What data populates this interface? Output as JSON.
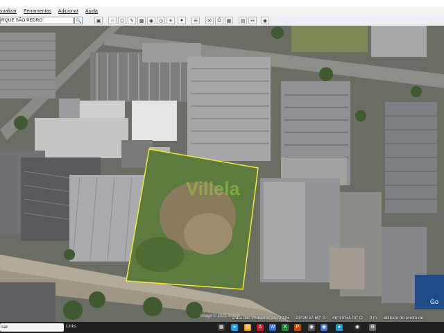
{
  "menu": {
    "items": [
      "sualizar",
      "Ferramentas",
      "Adicionar",
      "Ajuda"
    ]
  },
  "search": {
    "value": "RQUE SÃO PEDRO"
  },
  "map": {
    "watermark": "Villela",
    "image_credit": "Image © 2025 Airbus",
    "imagery_date": "Data das imagens: 3/2/2025",
    "latitude": "23°26'37.60\" S",
    "longitude": "46°19'59.73\" O",
    "elevation_prefix": "0 m",
    "eye_altitude": "altitude do ponto de"
  },
  "minimap": {
    "label": "Go"
  },
  "taskbar": {
    "search_text": "isar",
    "links_label": "Links"
  },
  "colors": {
    "boundary": "#f2ea3a",
    "vegetation": "#5b7a3e",
    "roof": "#8e9093",
    "accent": "#3b78d8"
  }
}
